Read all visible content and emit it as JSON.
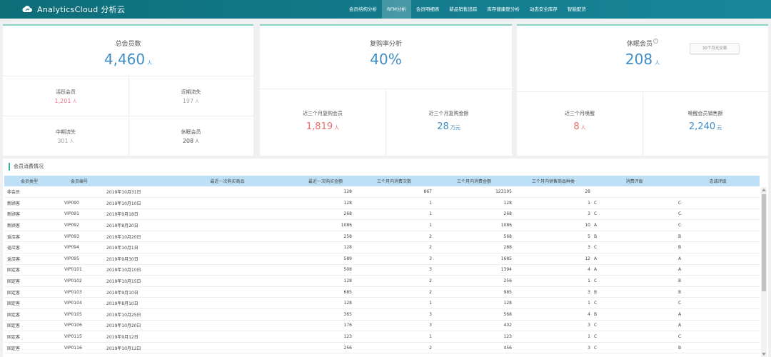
{
  "brand": {
    "name": "AnalyticsCloud 分析云"
  },
  "nav": {
    "items": [
      {
        "label": "会员结构分析"
      },
      {
        "label": "RFM分析"
      },
      {
        "label": "会员明细表"
      },
      {
        "label": "新品销售追踪"
      },
      {
        "label": "库存健康度分析"
      },
      {
        "label": "动态安全库存"
      },
      {
        "label": "智能配货"
      }
    ],
    "active_index": 1
  },
  "card1": {
    "title": "总会员数",
    "value": "4,460",
    "unit": "人",
    "active": {
      "label": "活跃会员",
      "value": "1,201",
      "unit": "人"
    },
    "recent_lost": {
      "label": "近期流失",
      "value": "197",
      "unit": "人"
    },
    "mid_lost": {
      "label": "中期流失",
      "value": "301",
      "unit": "人"
    },
    "dormant": {
      "label": "休眠会员",
      "value": "208",
      "unit": "人"
    }
  },
  "card2": {
    "title": "复购率分析",
    "value": "40%",
    "repeat_members": {
      "label": "近三个月复购会员",
      "value": "1,819",
      "unit": "人"
    },
    "repeat_amount": {
      "label": "近三个月复购金额",
      "value": "28",
      "unit": "万元"
    }
  },
  "card3": {
    "title": "休眠会员",
    "value": "208",
    "unit": "人",
    "dropdown": "30个月无交易",
    "woken": {
      "label": "近三个月唤醒",
      "value": "8",
      "unit": "人"
    },
    "woken_sales": {
      "label": "唤醒会员销售额",
      "value": "2,240",
      "unit": "元"
    }
  },
  "table": {
    "section_title": "会员消费情况",
    "columns": [
      "会员类型",
      "会员编号",
      "",
      "最近一次购买商品",
      "最近一次购买金额",
      "三个月内消费次数",
      "三个月内消费金额",
      "三个月内销售商品种类",
      "消费评级",
      "忠诚评级"
    ],
    "rows": [
      [
        "非会员",
        "",
        "2019年10月31日",
        "",
        "128",
        "867",
        "123105",
        "28",
        "",
        ""
      ],
      [
        "新顾客",
        "VIP090",
        "2019年10月10日",
        "",
        "128",
        "1",
        "128",
        "1",
        "C",
        "C"
      ],
      [
        "新顾客",
        "VIP091",
        "2019年9月18日",
        "",
        "268",
        "1",
        "268",
        "3",
        "C",
        "C"
      ],
      [
        "新顾客",
        "VIP092",
        "2019年8月20日",
        "",
        "1086",
        "1",
        "1086",
        "10",
        "A",
        "C"
      ],
      [
        "返店客",
        "VIP093",
        "2019年10月20日",
        "",
        "258",
        "2",
        "568",
        "5",
        "B",
        "B"
      ],
      [
        "返店客",
        "VIP094",
        "2019年10月1日",
        "",
        "128",
        "2",
        "288",
        "3",
        "C",
        "B"
      ],
      [
        "返店客",
        "VIP095",
        "2019年9月30日",
        "",
        "589",
        "3",
        "1685",
        "12",
        "A",
        "A"
      ],
      [
        "固定客",
        "VIP0101",
        "2019年10月10日",
        "",
        "508",
        "3",
        "1394",
        "4",
        "A",
        "A"
      ],
      [
        "固定客",
        "VIP0102",
        "2019年10月15日",
        "",
        "128",
        "2",
        "256",
        "1",
        "C",
        "B"
      ],
      [
        "固定客",
        "VIP0103",
        "2019年9月10日",
        "",
        "685",
        "2",
        "985",
        "3",
        "B",
        "B"
      ],
      [
        "固定客",
        "VIP0104",
        "2019年8月10日",
        "",
        "128",
        "1",
        "128",
        "1",
        "C",
        "C"
      ],
      [
        "固定客",
        "VIP0105",
        "2019年10月25日",
        "",
        "365",
        "3",
        "568",
        "4",
        "B",
        "A"
      ],
      [
        "固定客",
        "VIP0106",
        "2019年10月20日",
        "",
        "176",
        "3",
        "402",
        "3",
        "C",
        "A"
      ],
      [
        "固定客",
        "VIP0115",
        "2019年9月12日",
        "",
        "123",
        "1",
        "123",
        "1",
        "C",
        "C"
      ],
      [
        "固定客",
        "VIP0116",
        "2019年10月12日",
        "",
        "256",
        "2",
        "456",
        "3",
        "C",
        "B"
      ]
    ]
  },
  "colors": {
    "header": "#12798a",
    "accent": "#3ab5a3",
    "number_blue": "#3f8dc6",
    "number_red": "#e86b6b",
    "number_pink": "#e8738a",
    "table_header": "#bde0f6"
  }
}
